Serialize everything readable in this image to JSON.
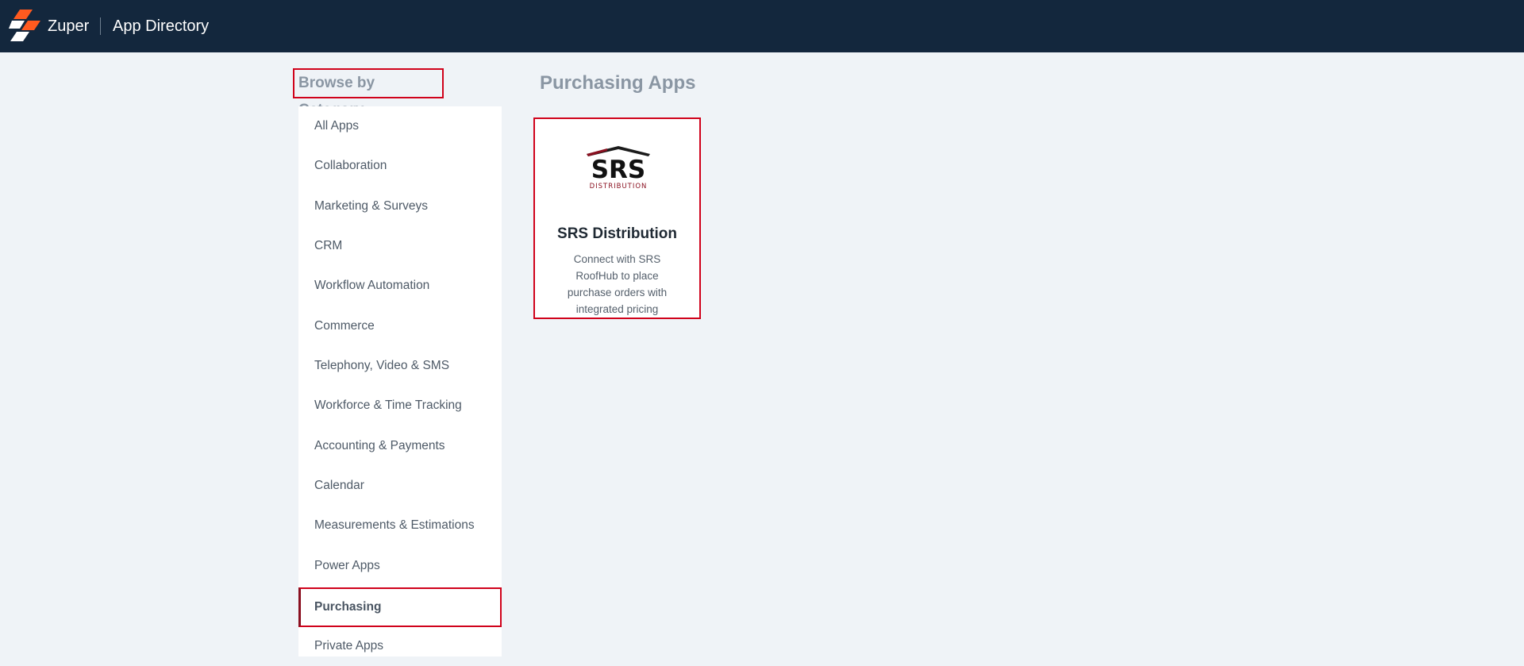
{
  "header": {
    "brand": "Zuper",
    "title": "App Directory"
  },
  "sidebar": {
    "title": "Browse by Category",
    "items": [
      {
        "label": "All Apps"
      },
      {
        "label": "Collaboration"
      },
      {
        "label": "Marketing & Surveys"
      },
      {
        "label": "CRM"
      },
      {
        "label": "Workflow Automation"
      },
      {
        "label": "Commerce"
      },
      {
        "label": "Telephony, Video & SMS"
      },
      {
        "label": "Workforce & Time Tracking"
      },
      {
        "label": "Accounting & Payments"
      },
      {
        "label": "Calendar"
      },
      {
        "label": "Measurements & Estimations"
      },
      {
        "label": "Power Apps"
      },
      {
        "label": "Purchasing"
      },
      {
        "label": "Private Apps"
      }
    ],
    "active_item": "Purchasing"
  },
  "main": {
    "section_title": "Purchasing Apps",
    "apps": [
      {
        "name": "SRS Distribution",
        "description": "Connect with SRS RoofHub to place purchase orders with integrated pricing",
        "logo_icon": "srs-distribution-logo",
        "logo_text": "SRS",
        "logo_subtext": "DISTRIBUTION"
      }
    ]
  },
  "colors": {
    "topbar": "#13273d",
    "background": "#eff3f7",
    "highlight_border": "#d0021b",
    "logo_orange": "#ff5a1f",
    "srs_red": "#8a1020"
  }
}
